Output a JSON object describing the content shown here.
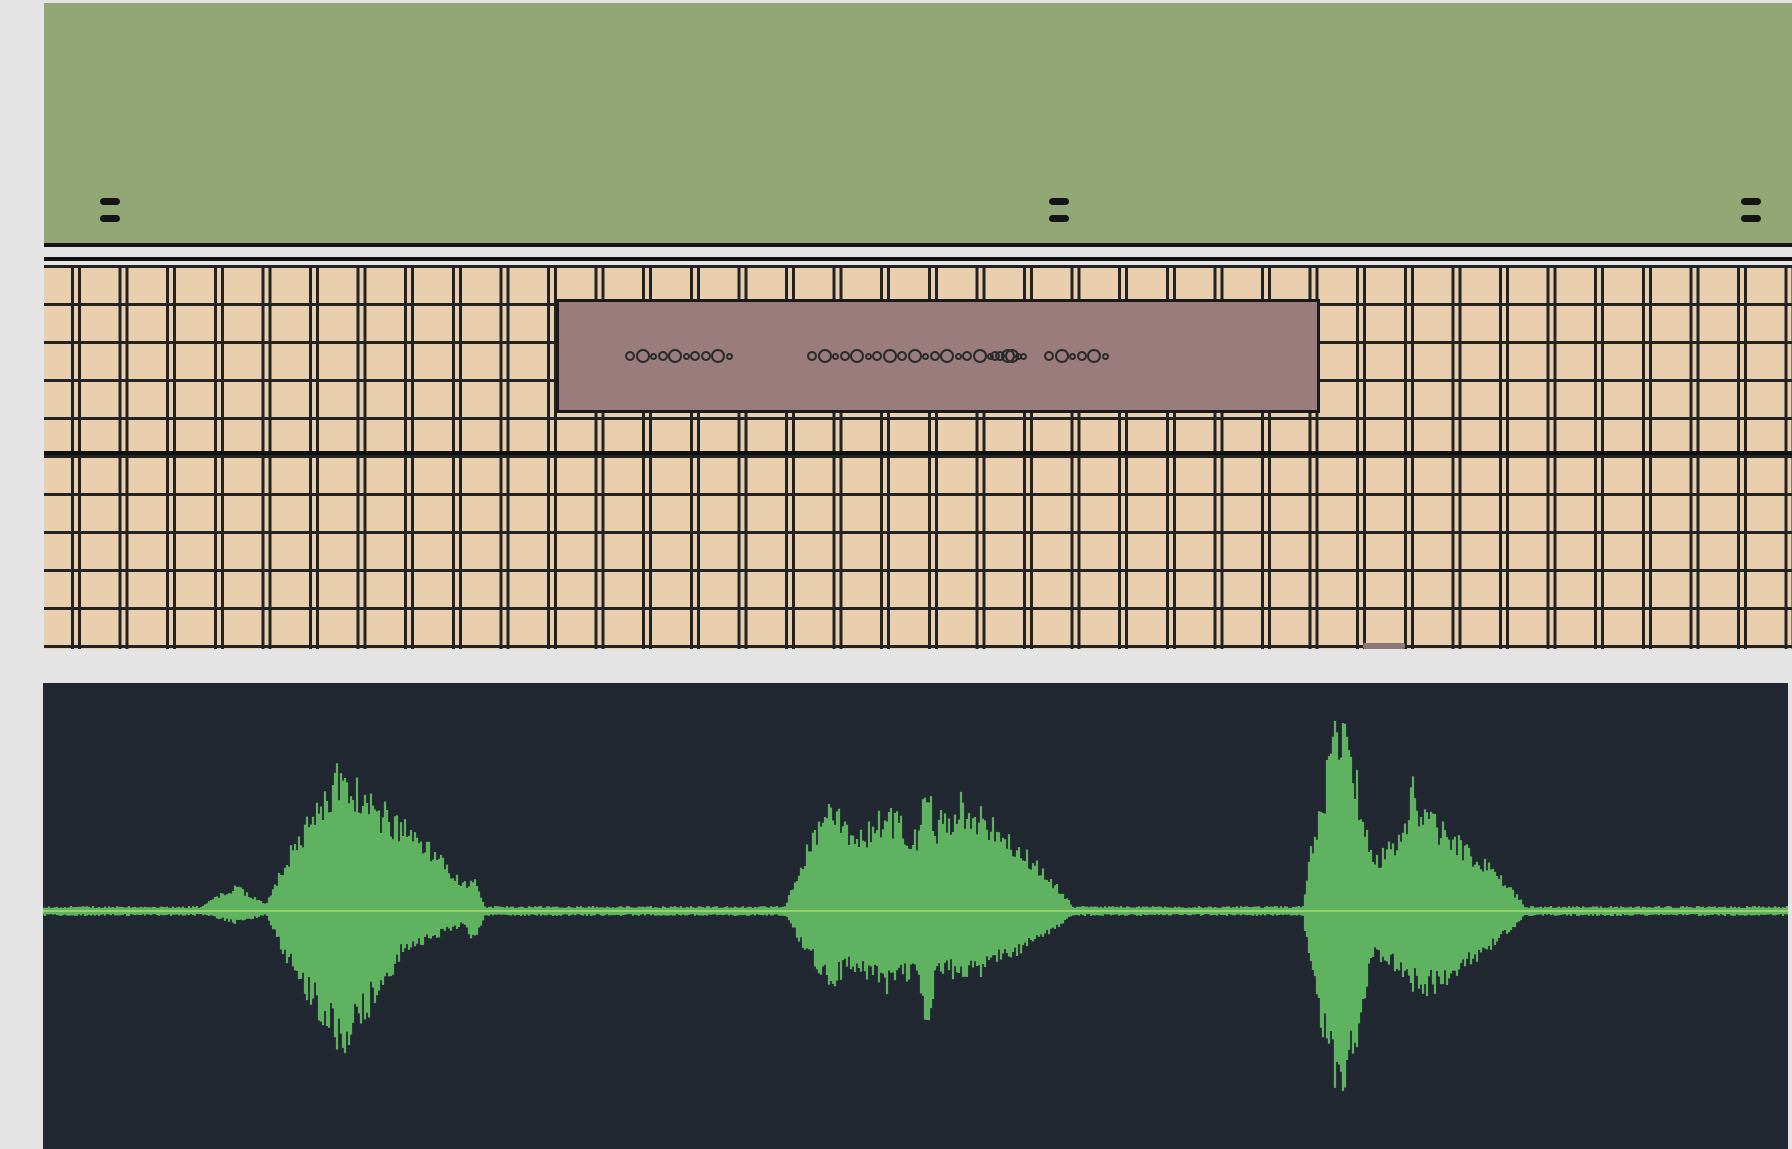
{
  "editor": {
    "ruler_markers": [
      "marker-1",
      "marker-2",
      "marker-3"
    ],
    "clip": {
      "label_icon": "dotted-note-glyphs",
      "color": "#9a7c7c"
    },
    "colors": {
      "ruler": "#92a676",
      "grid": "#e9cfae",
      "grid_lines": "#232323"
    }
  },
  "waveform": {
    "color": "#5fb25f",
    "center_line_color": "#a6dc6a",
    "background": "#212832"
  }
}
